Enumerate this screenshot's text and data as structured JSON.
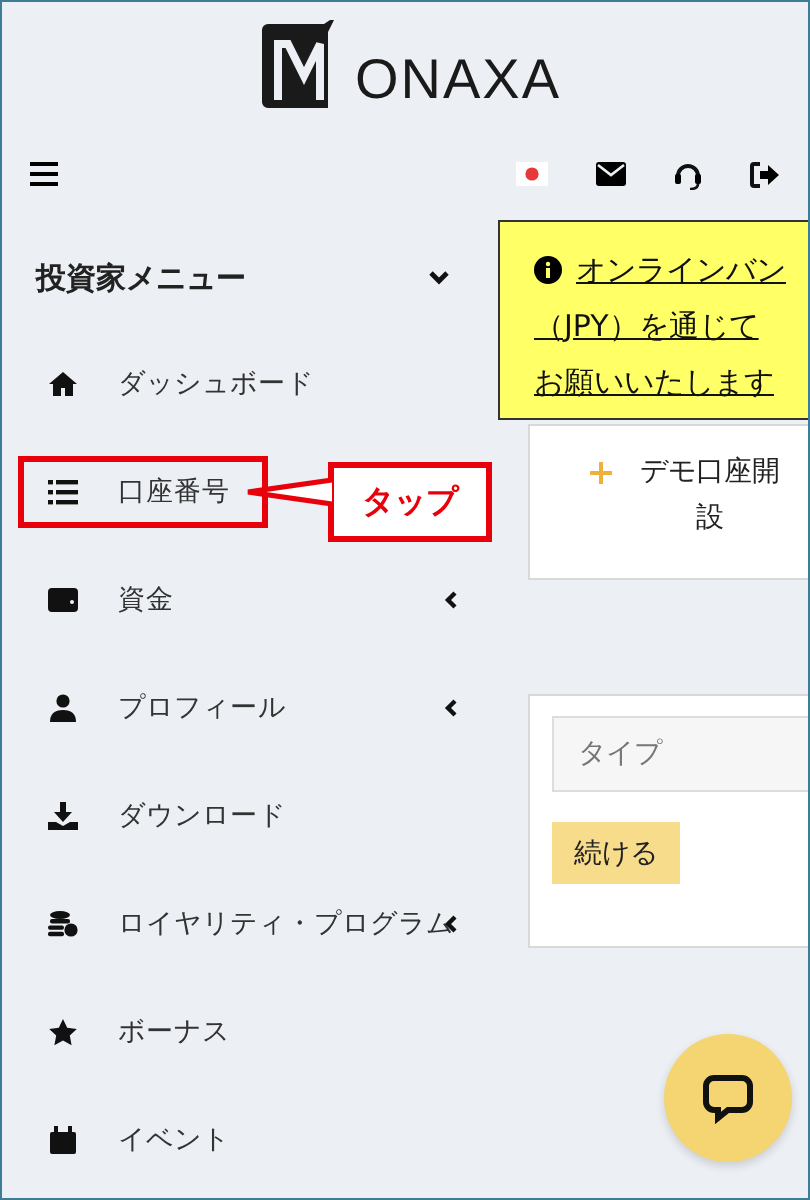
{
  "logo": {
    "text": "ONAXA"
  },
  "sidebar": {
    "title": "投資家メニュー",
    "expanded": true,
    "items": [
      {
        "label": "ダッシュボード",
        "expandable": false,
        "highlighted": false
      },
      {
        "label": "口座番号",
        "expandable": false,
        "highlighted": true
      },
      {
        "label": "資金",
        "expandable": true,
        "highlighted": false
      },
      {
        "label": "プロフィール",
        "expandable": true,
        "highlighted": false
      },
      {
        "label": "ダウンロード",
        "expandable": false,
        "highlighted": false
      },
      {
        "label": "ロイヤリティ・プログラム",
        "expandable": true,
        "highlighted": false
      },
      {
        "label": "ボーナス",
        "expandable": false,
        "highlighted": false
      },
      {
        "label": "イベント",
        "expandable": false,
        "highlighted": false
      }
    ]
  },
  "annotation": {
    "text": "タップ"
  },
  "notice": {
    "lines": [
      "オンラインバン",
      "（JPY）を通じて",
      "お願いいたします"
    ]
  },
  "demo_card": {
    "label": "デモ口座開設"
  },
  "form": {
    "placeholder": "タイプ",
    "button": "続ける"
  }
}
